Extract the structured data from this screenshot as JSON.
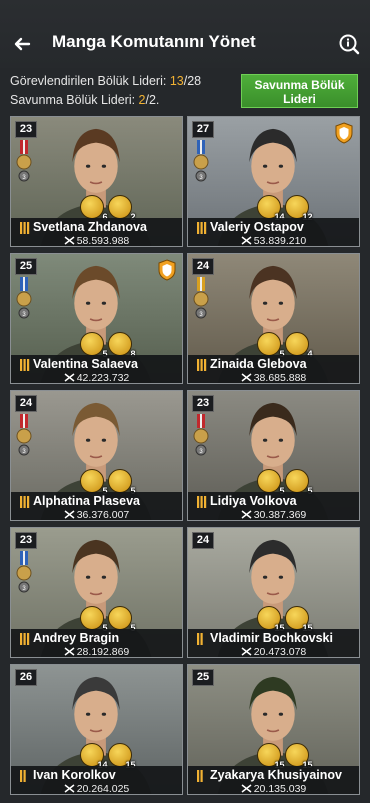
{
  "header": {
    "title": "Manga Komutanını Yönet"
  },
  "stats": {
    "assigned_label": "Görevlendirilen Bölük Lideri: ",
    "assigned_current": "13",
    "assigned_total": "/28",
    "defense_label": "Savunma Bölük Lideri: ",
    "defense_current": "2",
    "defense_total": "/2."
  },
  "defense_button": {
    "line1": "Savunma Bölük",
    "line2": "Lideri"
  },
  "colors": {
    "accent_gold": "#f2b233",
    "button_green": "#4fae3a",
    "shield_orange": "#f0a020"
  },
  "commanders": [
    {
      "level": "23",
      "name": "Svetlana Zhdanova",
      "power": "58.593.988",
      "rank": "III",
      "skills": [
        "6",
        "2"
      ],
      "defense": false,
      "medal": "red"
    },
    {
      "level": "27",
      "name": "Valeriy Ostapov",
      "power": "53.839.210",
      "rank": "III",
      "skills": [
        "14",
        "12"
      ],
      "defense": true,
      "medal": "blue"
    },
    {
      "level": "25",
      "name": "Valentina Salaeva",
      "power": "42.223.732",
      "rank": "III",
      "skills": [
        "5",
        "8"
      ],
      "defense": true,
      "medal": "blue"
    },
    {
      "level": "24",
      "name": "Zinaida Glebova",
      "power": "38.685.888",
      "rank": "III",
      "skills": [
        "5",
        "4"
      ],
      "defense": false,
      "medal": "gold"
    },
    {
      "level": "24",
      "name": "Alphatina Plaseva",
      "power": "36.376.007",
      "rank": "III",
      "skills": [
        "5",
        "5"
      ],
      "defense": false,
      "medal": "red"
    },
    {
      "level": "23",
      "name": "Lidiya Volkova",
      "power": "30.387.369",
      "rank": "III",
      "skills": [
        "5",
        "5"
      ],
      "defense": false,
      "medal": "red"
    },
    {
      "level": "23",
      "name": "Andrey Bragin",
      "power": "28.192.869",
      "rank": "III",
      "skills": [
        "5",
        "5"
      ],
      "defense": false,
      "medal": "blue"
    },
    {
      "level": "24",
      "name": "Vladimir Bochkovski",
      "power": "20.473.078",
      "rank": "II",
      "skills": [
        "15",
        "15"
      ],
      "defense": false,
      "medal": "none"
    },
    {
      "level": "26",
      "name": "Ivan Korolkov",
      "power": "20.264.025",
      "rank": "II",
      "skills": [
        "14",
        "15"
      ],
      "defense": false,
      "medal": "none"
    },
    {
      "level": "25",
      "name": "Zyakarya Khusiyainov",
      "power": "20.135.039",
      "rank": "II",
      "skills": [
        "15",
        "15"
      ],
      "defense": false,
      "medal": "none"
    }
  ]
}
